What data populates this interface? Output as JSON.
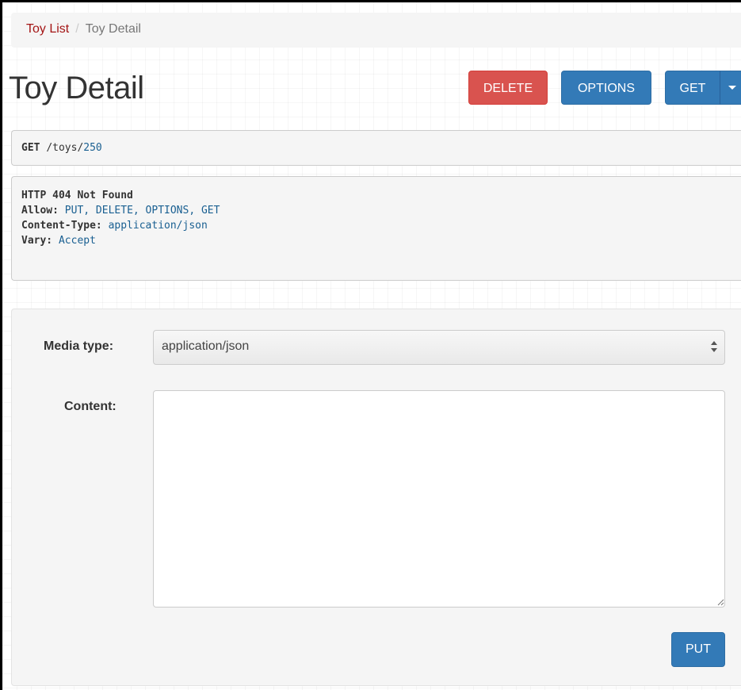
{
  "breadcrumb": {
    "items": [
      {
        "label": "Toy List"
      },
      {
        "label": "Toy Detail"
      }
    ],
    "separator": "/"
  },
  "page": {
    "title": "Toy Detail"
  },
  "toolbar": {
    "delete_label": "DELETE",
    "options_label": "OPTIONS",
    "get_label": "GET",
    "delete_color": "#d9534f",
    "primary_color": "#337ab7"
  },
  "request": {
    "method": "GET",
    "path_prefix": "/toys/",
    "id": "250"
  },
  "response": {
    "status": "HTTP 404 Not Found",
    "headers": [
      {
        "name": "Allow:",
        "value": "PUT, DELETE, OPTIONS, GET"
      },
      {
        "name": "Content-Type:",
        "value": "application/json"
      },
      {
        "name": "Vary:",
        "value": "Accept"
      }
    ]
  },
  "form": {
    "media_type_label": "Media type:",
    "media_type_value": "application/json",
    "content_label": "Content:",
    "content_value": "",
    "put_label": "PUT"
  },
  "icons": {
    "select_arrows": "select-updown-icon",
    "dropdown_caret": "caret-down-icon",
    "resize_grip": "resize-grip-icon"
  }
}
